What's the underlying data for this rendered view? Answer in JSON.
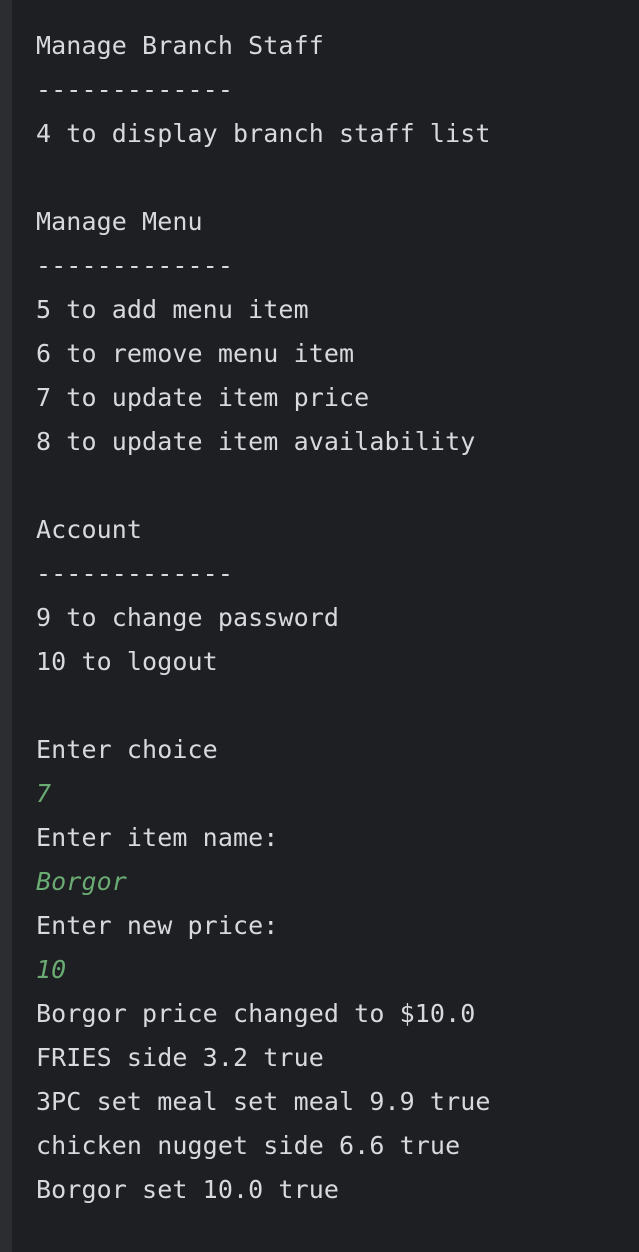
{
  "colors": {
    "background": "#1e1f22",
    "gutter": "#2b2d30",
    "output_text": "#d8d9dc",
    "user_input_text": "#6aab73"
  },
  "console": {
    "lines": [
      {
        "text": "Manage Branch Staff",
        "kind": "output"
      },
      {
        "text": "-------------",
        "kind": "output"
      },
      {
        "text": "4 to display branch staff list",
        "kind": "output"
      },
      {
        "text": "",
        "kind": "output"
      },
      {
        "text": "Manage Menu",
        "kind": "output"
      },
      {
        "text": "-------------",
        "kind": "output"
      },
      {
        "text": "5 to add menu item",
        "kind": "output"
      },
      {
        "text": "6 to remove menu item",
        "kind": "output"
      },
      {
        "text": "7 to update item price",
        "kind": "output"
      },
      {
        "text": "8 to update item availability",
        "kind": "output"
      },
      {
        "text": "",
        "kind": "output"
      },
      {
        "text": "Account",
        "kind": "output"
      },
      {
        "text": "-------------",
        "kind": "output"
      },
      {
        "text": "9 to change password",
        "kind": "output"
      },
      {
        "text": "10 to logout",
        "kind": "output"
      },
      {
        "text": "",
        "kind": "output"
      },
      {
        "text": "Enter choice",
        "kind": "output"
      },
      {
        "text": "7",
        "kind": "input"
      },
      {
        "text": "Enter item name:",
        "kind": "output"
      },
      {
        "text": "Borgor",
        "kind": "input"
      },
      {
        "text": "Enter new price:",
        "kind": "output"
      },
      {
        "text": "10",
        "kind": "input"
      },
      {
        "text": "Borgor price changed to $10.0",
        "kind": "output"
      },
      {
        "text": "FRIES side 3.2 true",
        "kind": "output"
      },
      {
        "text": "3PC set meal set meal 9.9 true",
        "kind": "output"
      },
      {
        "text": "chicken nugget side 6.6 true",
        "kind": "output"
      },
      {
        "text": "Borgor set 10.0 true",
        "kind": "output"
      }
    ]
  }
}
